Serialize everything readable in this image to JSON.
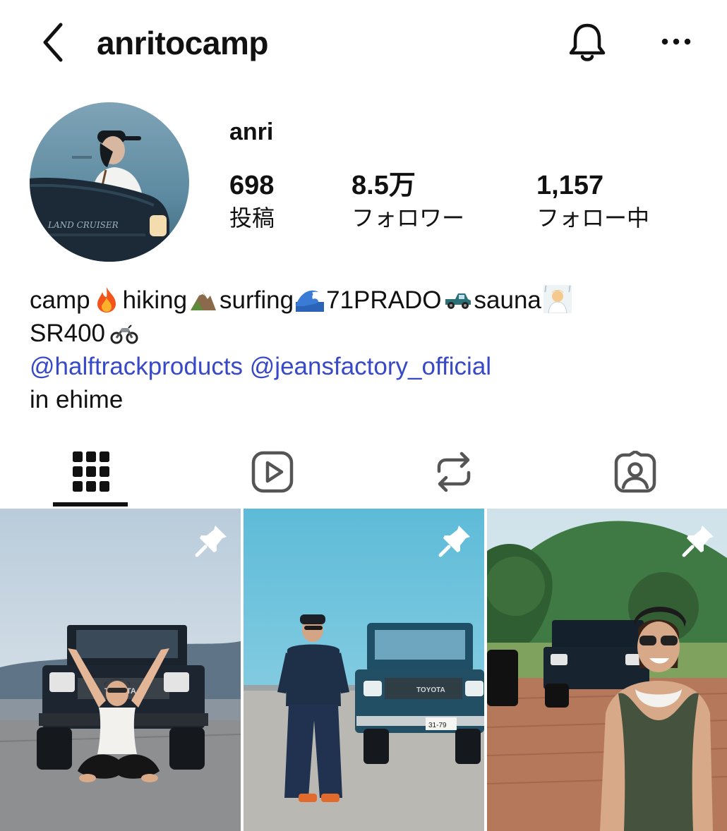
{
  "header": {
    "username": "anritocamp",
    "back_icon": "chevron-left-icon",
    "bell_icon": "bell-icon",
    "more_icon": "more-horizontal-icon"
  },
  "profile": {
    "display_name": "anri",
    "stats": [
      {
        "value": "698",
        "label": "投稿"
      },
      {
        "value": "8.5万",
        "label": "フォロワー"
      },
      {
        "value": "1,157",
        "label": "フォロー中"
      }
    ]
  },
  "bio": {
    "words": [
      "camp",
      "hiking",
      "surfing",
      "71PRADO",
      "sauna",
      "SR400"
    ],
    "emojis": [
      "fire-emoji",
      "mountain-emoji",
      "wave-emoji",
      "pickup-truck-emoji",
      "sauna-person-emoji",
      "motorcycle-emoji"
    ],
    "mentions": [
      "@halftrackproducts",
      "@jeansfactory_official"
    ],
    "location": "in ehime"
  },
  "tabs": [
    {
      "name": "posts",
      "icon": "grid-icon",
      "active": true
    },
    {
      "name": "reels",
      "icon": "reels-icon",
      "active": false
    },
    {
      "name": "reposts",
      "icon": "repost-icon",
      "active": false
    },
    {
      "name": "tagged",
      "icon": "tagged-person-icon",
      "active": false
    }
  ],
  "posts": [
    {
      "pinned": true,
      "subject": "woman seated before black Land Cruiser"
    },
    {
      "pinned": true,
      "subject": "person in denim beside teal Land Cruiser"
    },
    {
      "pinned": true,
      "subject": "smiling woman in front of black truck"
    }
  ],
  "colors": {
    "mention": "#3749c8",
    "text": "#111111",
    "background": "#ffffff"
  }
}
